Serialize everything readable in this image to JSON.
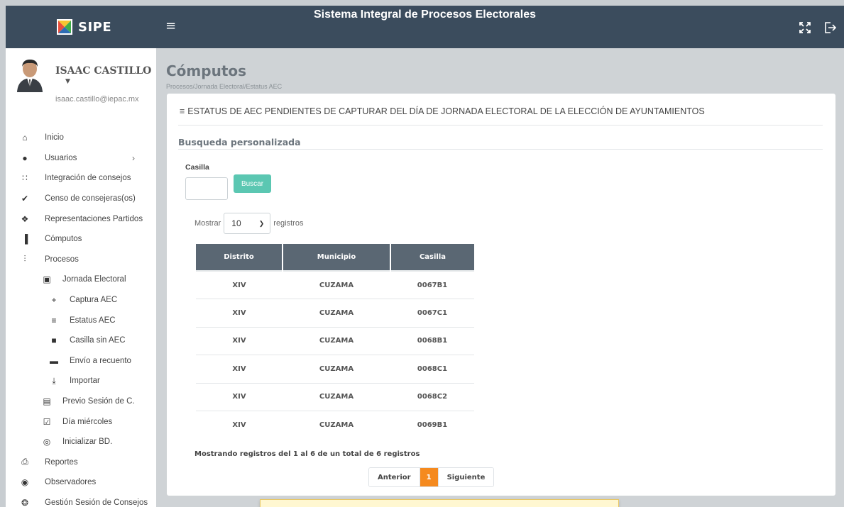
{
  "header": {
    "brand": "SIPE",
    "title": "Sistema Integral de Procesos Electorales",
    "icons": [
      "hamburger-icon",
      "fullscreen-icon",
      "logout-icon"
    ]
  },
  "user": {
    "name": "ISAAC CASTILLO",
    "email": "isaac.castillo@iepac.mx"
  },
  "sidebar": {
    "items": [
      {
        "label": "Inicio",
        "icon": "home-icon",
        "level": 0
      },
      {
        "label": "Usuarios",
        "icon": "users-icon",
        "level": 0,
        "chevron": true
      },
      {
        "label": "Integración de consejos",
        "icon": "group-icon",
        "level": 0
      },
      {
        "label": "Censo de consejeras(os)",
        "icon": "check-icon",
        "level": 0
      },
      {
        "label": "Representaciones Partidos",
        "icon": "team-icon",
        "level": 0
      },
      {
        "label": "Cómputos",
        "icon": "bar-chart-icon",
        "level": 0
      },
      {
        "label": "Procesos",
        "icon": "sliders-icon",
        "level": 0
      },
      {
        "label": "Jornada Electoral",
        "icon": "file-plus-icon",
        "level": 1
      },
      {
        "label": "Captura AEC",
        "icon": "plus-icon",
        "level": 2
      },
      {
        "label": "Estatus AEC",
        "icon": "list-icon",
        "level": 2
      },
      {
        "label": "Casilla sin AEC",
        "icon": "alert-message-icon",
        "level": 2
      },
      {
        "label": "Envío a recuento",
        "icon": "chat-icon",
        "level": 2
      },
      {
        "label": "Importar",
        "icon": "download-icon",
        "level": 2
      },
      {
        "label": "Previo Sesión de C.",
        "icon": "document-icon",
        "level": 1
      },
      {
        "label": "Día miércoles",
        "icon": "clipboard-check-icon",
        "level": 1
      },
      {
        "label": "Inicializar BD.",
        "icon": "database-icon",
        "level": 1
      },
      {
        "label": "Reportes",
        "icon": "printer-icon",
        "level": 0
      },
      {
        "label": "Observadores",
        "icon": "eye-icon",
        "level": 0
      },
      {
        "label": "Gestión Sesión de Consejos",
        "icon": "gear-icon",
        "level": 0
      }
    ]
  },
  "main": {
    "title": "Cómputos",
    "breadcrumb": "Procesos/Jornada Electoral/Estatus AEC",
    "card_title": "ESTATUS DE AEC PENDIENTES DE CAPTURAR DEL DÍA DE JORNADA ELECTORAL DE LA ELECCIÓN DE AYUNTAMIENTOS",
    "search": {
      "section_title": "Busqueda personalizada",
      "label": "Casilla",
      "value": "",
      "button": "Buscar"
    },
    "length": {
      "prefix": "Mostrar",
      "value": "10",
      "suffix": "registros"
    },
    "table": {
      "columns": [
        "Distrito",
        "Municipio",
        "Casilla"
      ],
      "rows": [
        [
          "XIV",
          "CUZAMA",
          "0067B1"
        ],
        [
          "XIV",
          "CUZAMA",
          "0067C1"
        ],
        [
          "XIV",
          "CUZAMA",
          "0068B1"
        ],
        [
          "XIV",
          "CUZAMA",
          "0068C1"
        ],
        [
          "XIV",
          "CUZAMA",
          "0068C2"
        ],
        [
          "XIV",
          "CUZAMA",
          "0069B1"
        ]
      ]
    },
    "info": "Mostrando registros del 1 al 6 de un total de 6 registros",
    "pagination": {
      "prev": "Anterior",
      "current": "1",
      "next": "Siguiente"
    }
  },
  "colors": {
    "topbar": "#3b4c5d",
    "accent_button": "#5bc7b2",
    "page_active": "#f58a1f",
    "table_header": "#5a6773"
  }
}
